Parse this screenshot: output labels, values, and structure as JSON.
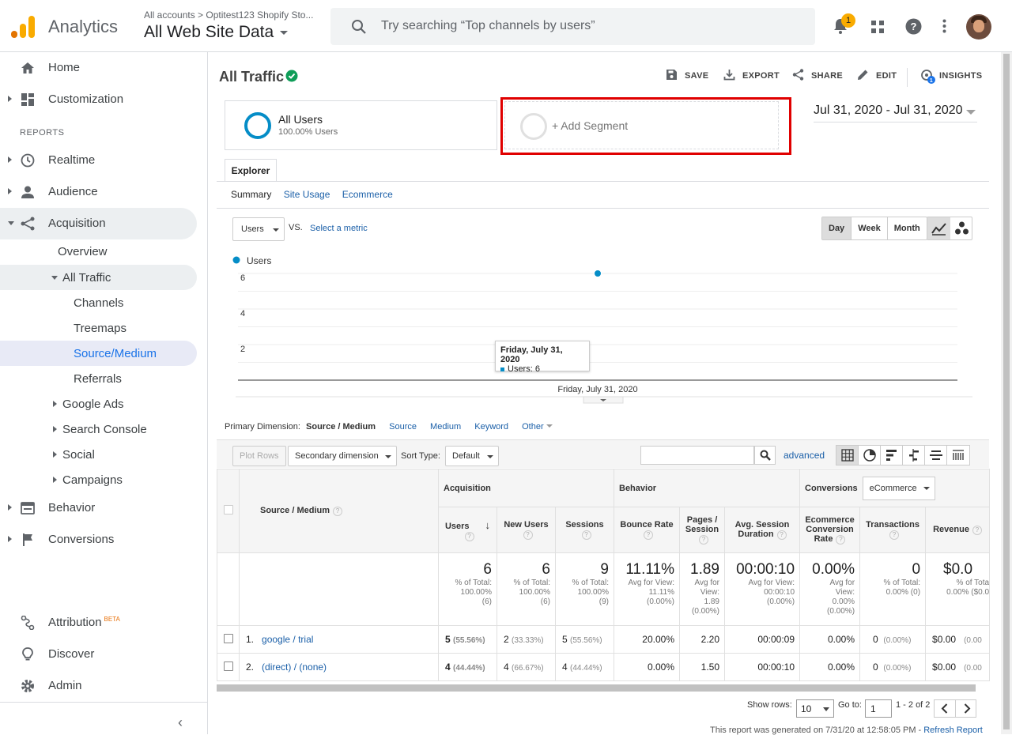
{
  "topbar": {
    "app_name": "Analytics",
    "account_crumb": "All accounts > Optitest123 Shopify Sto...",
    "view_name": "All Web Site Data",
    "search_placeholder": "Try searching “Top channels by users”",
    "notification_count": "1",
    "brand_colors": {
      "logo_orange": "#f9ab00",
      "logo_dark": "#e37400"
    }
  },
  "sidebar": {
    "home": "Home",
    "customization": "Customization",
    "reports_label": "REPORTS",
    "realtime": "Realtime",
    "audience": "Audience",
    "acquisition": "Acquisition",
    "overview": "Overview",
    "all_traffic": "All Traffic",
    "channels": "Channels",
    "treemaps": "Treemaps",
    "source_medium": "Source/Medium",
    "referrals": "Referrals",
    "google_ads": "Google Ads",
    "search_console": "Search Console",
    "social": "Social",
    "campaigns": "Campaigns",
    "behavior": "Behavior",
    "conversions": "Conversions",
    "attribution": "Attribution",
    "beta": "BETA",
    "discover": "Discover",
    "admin": "Admin",
    "collapse_glyph": "‹"
  },
  "report": {
    "title": "All Traffic",
    "save": "SAVE",
    "export": "EXPORT",
    "share": "SHARE",
    "edit": "EDIT",
    "insights": "INSIGHTS",
    "insights_count": "1",
    "segment_name": "All Users",
    "segment_sub": "100.00% Users",
    "add_segment": "+ Add Segment",
    "date_range": "Jul 31, 2020 - Jul 31, 2020",
    "explorer_tab": "Explorer",
    "subtabs": [
      "Summary",
      "Site Usage",
      "Ecommerce"
    ],
    "metric": "Users",
    "vs": "VS.",
    "select_metric": "Select a metric",
    "period_buttons": [
      "Day",
      "Week",
      "Month"
    ]
  },
  "chart_data": {
    "type": "line",
    "series": [
      {
        "name": "Users",
        "x": [
          "Friday, July 31, 2020"
        ],
        "values": [
          6
        ]
      }
    ],
    "y_ticks": [
      2,
      4,
      6
    ],
    "x_label": "Friday, July 31, 2020",
    "tooltip_title": "Friday, July 31, 2020",
    "tooltip_value": "Users: 6",
    "color": "#058dc7",
    "grid": true,
    "legend": "top-left"
  },
  "table": {
    "primary_dimension_label": "Primary Dimension:",
    "primary_dimension": "Source / Medium",
    "dim_links": [
      "Source",
      "Medium",
      "Keyword",
      "Other"
    ],
    "plot_rows": "Plot Rows",
    "secondary_dimension": "Secondary dimension",
    "sort_type_label": "Sort Type:",
    "sort_type": "Default",
    "advanced": "advanced",
    "groups": {
      "acquisition": "Acquisition",
      "behavior": "Behavior",
      "conversions": "Conversions",
      "conv_select": "eCommerce"
    },
    "dim_header": "Source / Medium",
    "headers": {
      "users": "Users",
      "new_users": "New Users",
      "sessions": "Sessions",
      "bounce": "Bounce Rate",
      "pages1": "Pages /",
      "pages2": "Session",
      "avgdur1": "Avg. Session",
      "avgdur2": "Duration",
      "ecr1": "Ecommerce",
      "ecr2": "Conversion",
      "ecr3": "Rate",
      "transactions": "Transactions",
      "revenue": "Revenue"
    },
    "totals": {
      "users": "6",
      "users_sub1": "% of Total:",
      "users_sub2": "100.00%",
      "users_sub3": "(6)",
      "new_users": "6",
      "new_users_sub1": "% of Total:",
      "new_users_sub2": "100.00%",
      "new_users_sub3": "(6)",
      "sessions": "9",
      "sessions_sub1": "% of Total:",
      "sessions_sub2": "100.00%",
      "sessions_sub3": "(9)",
      "bounce": "11.11%",
      "bounce_sub1": "Avg for View:",
      "bounce_sub2": "11.11%",
      "bounce_sub3": "(0.00%)",
      "pages": "1.89",
      "pages_sub1": "Avg for",
      "pages_sub2": "View:",
      "pages_sub3": "1.89",
      "pages_sub4": "(0.00%)",
      "avgdur": "00:00:10",
      "avgdur_sub1": "Avg for View:",
      "avgdur_sub2": "00:00:10",
      "avgdur_sub3": "(0.00%)",
      "ecr": "0.00%",
      "ecr_sub1": "Avg for",
      "ecr_sub2": "View:",
      "ecr_sub3": "0.00%",
      "ecr_sub4": "(0.00%)",
      "transactions": "0",
      "transactions_sub1": "% of Total:",
      "transactions_sub2": "0.00% (0)",
      "revenue": "$0.0",
      "revenue_sub1": "% of Tota",
      "revenue_sub2": "0.00% ($0.0"
    },
    "rows": [
      {
        "num": "1.",
        "dim": "google / trial",
        "users": "5",
        "users_pct": "(55.56%)",
        "new_users": "2",
        "new_users_pct": "(33.33%)",
        "sessions": "5",
        "sessions_pct": "(55.56%)",
        "bounce": "20.00%",
        "pages": "2.20",
        "avgdur": "00:00:09",
        "ecr": "0.00%",
        "transactions": "0",
        "transactions_pct": "(0.00%)",
        "revenue": "$0.00",
        "revenue_pct": "(0.00"
      },
      {
        "num": "2.",
        "dim": "(direct) / (none)",
        "users": "4",
        "users_pct": "(44.44%)",
        "new_users": "4",
        "new_users_pct": "(66.67%)",
        "sessions": "4",
        "sessions_pct": "(44.44%)",
        "bounce": "0.00%",
        "pages": "1.50",
        "avgdur": "00:00:10",
        "ecr": "0.00%",
        "transactions": "0",
        "transactions_pct": "(0.00%)",
        "revenue": "$0.00",
        "revenue_pct": "(0.00"
      }
    ],
    "show_rows_label": "Show rows:",
    "show_rows": "10",
    "goto_label": "Go to:",
    "goto": "1",
    "range": "1 - 2 of 2",
    "footnote": "This report was generated on 7/31/20 at 12:58:05 PM -",
    "refresh": "Refresh Report"
  }
}
